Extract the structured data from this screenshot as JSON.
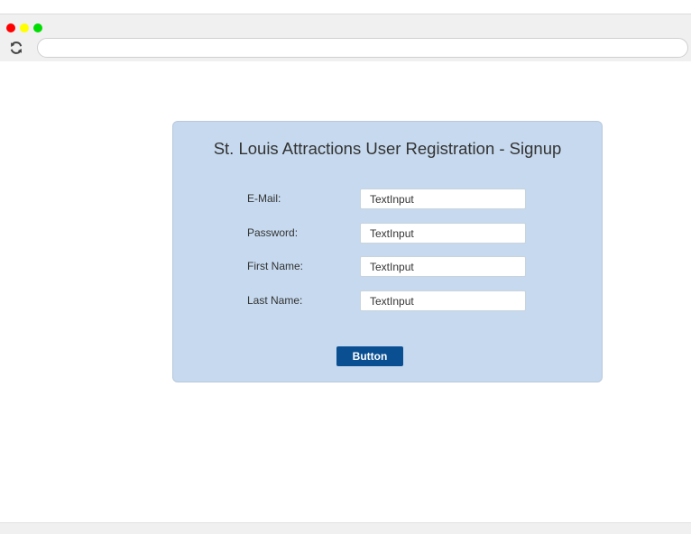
{
  "window": {
    "controls": [
      {
        "name": "close",
        "color": "#ff0000"
      },
      {
        "name": "minimize",
        "color": "#ffff00"
      },
      {
        "name": "maximize",
        "color": "#00dd00"
      }
    ],
    "address_value": ""
  },
  "form": {
    "title": "St. Louis Attractions User Registration - Signup",
    "fields": [
      {
        "label": "E-Mail:",
        "value": "TextInput"
      },
      {
        "label": "Password:",
        "value": "TextInput"
      },
      {
        "label": "First Name:",
        "value": "TextInput"
      },
      {
        "label": "Last Name:",
        "value": "TextInput"
      }
    ],
    "submit_label": "Button"
  },
  "colors": {
    "card_background": "#c6d9ee",
    "button_background": "#0b4f93",
    "chrome_background": "#f0f0f0"
  }
}
